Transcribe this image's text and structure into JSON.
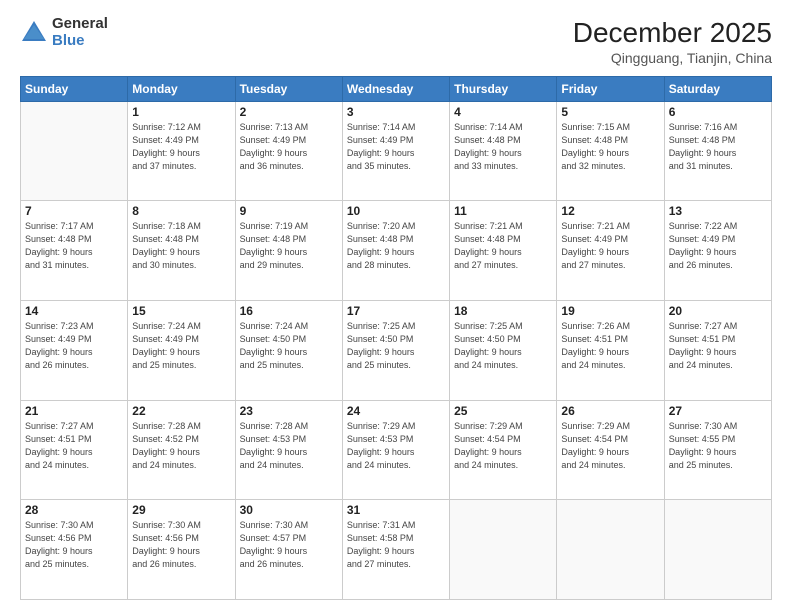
{
  "logo": {
    "general": "General",
    "blue": "Blue"
  },
  "title": {
    "month": "December 2025",
    "location": "Qingguang, Tianjin, China"
  },
  "days_header": [
    "Sunday",
    "Monday",
    "Tuesday",
    "Wednesday",
    "Thursday",
    "Friday",
    "Saturday"
  ],
  "weeks": [
    [
      {
        "day": "",
        "info": ""
      },
      {
        "day": "1",
        "info": "Sunrise: 7:12 AM\nSunset: 4:49 PM\nDaylight: 9 hours\nand 37 minutes."
      },
      {
        "day": "2",
        "info": "Sunrise: 7:13 AM\nSunset: 4:49 PM\nDaylight: 9 hours\nand 36 minutes."
      },
      {
        "day": "3",
        "info": "Sunrise: 7:14 AM\nSunset: 4:49 PM\nDaylight: 9 hours\nand 35 minutes."
      },
      {
        "day": "4",
        "info": "Sunrise: 7:14 AM\nSunset: 4:48 PM\nDaylight: 9 hours\nand 33 minutes."
      },
      {
        "day": "5",
        "info": "Sunrise: 7:15 AM\nSunset: 4:48 PM\nDaylight: 9 hours\nand 32 minutes."
      },
      {
        "day": "6",
        "info": "Sunrise: 7:16 AM\nSunset: 4:48 PM\nDaylight: 9 hours\nand 31 minutes."
      }
    ],
    [
      {
        "day": "7",
        "info": "Sunrise: 7:17 AM\nSunset: 4:48 PM\nDaylight: 9 hours\nand 31 minutes."
      },
      {
        "day": "8",
        "info": "Sunrise: 7:18 AM\nSunset: 4:48 PM\nDaylight: 9 hours\nand 30 minutes."
      },
      {
        "day": "9",
        "info": "Sunrise: 7:19 AM\nSunset: 4:48 PM\nDaylight: 9 hours\nand 29 minutes."
      },
      {
        "day": "10",
        "info": "Sunrise: 7:20 AM\nSunset: 4:48 PM\nDaylight: 9 hours\nand 28 minutes."
      },
      {
        "day": "11",
        "info": "Sunrise: 7:21 AM\nSunset: 4:48 PM\nDaylight: 9 hours\nand 27 minutes."
      },
      {
        "day": "12",
        "info": "Sunrise: 7:21 AM\nSunset: 4:49 PM\nDaylight: 9 hours\nand 27 minutes."
      },
      {
        "day": "13",
        "info": "Sunrise: 7:22 AM\nSunset: 4:49 PM\nDaylight: 9 hours\nand 26 minutes."
      }
    ],
    [
      {
        "day": "14",
        "info": "Sunrise: 7:23 AM\nSunset: 4:49 PM\nDaylight: 9 hours\nand 26 minutes."
      },
      {
        "day": "15",
        "info": "Sunrise: 7:24 AM\nSunset: 4:49 PM\nDaylight: 9 hours\nand 25 minutes."
      },
      {
        "day": "16",
        "info": "Sunrise: 7:24 AM\nSunset: 4:50 PM\nDaylight: 9 hours\nand 25 minutes."
      },
      {
        "day": "17",
        "info": "Sunrise: 7:25 AM\nSunset: 4:50 PM\nDaylight: 9 hours\nand 25 minutes."
      },
      {
        "day": "18",
        "info": "Sunrise: 7:25 AM\nSunset: 4:50 PM\nDaylight: 9 hours\nand 24 minutes."
      },
      {
        "day": "19",
        "info": "Sunrise: 7:26 AM\nSunset: 4:51 PM\nDaylight: 9 hours\nand 24 minutes."
      },
      {
        "day": "20",
        "info": "Sunrise: 7:27 AM\nSunset: 4:51 PM\nDaylight: 9 hours\nand 24 minutes."
      }
    ],
    [
      {
        "day": "21",
        "info": "Sunrise: 7:27 AM\nSunset: 4:51 PM\nDaylight: 9 hours\nand 24 minutes."
      },
      {
        "day": "22",
        "info": "Sunrise: 7:28 AM\nSunset: 4:52 PM\nDaylight: 9 hours\nand 24 minutes."
      },
      {
        "day": "23",
        "info": "Sunrise: 7:28 AM\nSunset: 4:53 PM\nDaylight: 9 hours\nand 24 minutes."
      },
      {
        "day": "24",
        "info": "Sunrise: 7:29 AM\nSunset: 4:53 PM\nDaylight: 9 hours\nand 24 minutes."
      },
      {
        "day": "25",
        "info": "Sunrise: 7:29 AM\nSunset: 4:54 PM\nDaylight: 9 hours\nand 24 minutes."
      },
      {
        "day": "26",
        "info": "Sunrise: 7:29 AM\nSunset: 4:54 PM\nDaylight: 9 hours\nand 24 minutes."
      },
      {
        "day": "27",
        "info": "Sunrise: 7:30 AM\nSunset: 4:55 PM\nDaylight: 9 hours\nand 25 minutes."
      }
    ],
    [
      {
        "day": "28",
        "info": "Sunrise: 7:30 AM\nSunset: 4:56 PM\nDaylight: 9 hours\nand 25 minutes."
      },
      {
        "day": "29",
        "info": "Sunrise: 7:30 AM\nSunset: 4:56 PM\nDaylight: 9 hours\nand 26 minutes."
      },
      {
        "day": "30",
        "info": "Sunrise: 7:30 AM\nSunset: 4:57 PM\nDaylight: 9 hours\nand 26 minutes."
      },
      {
        "day": "31",
        "info": "Sunrise: 7:31 AM\nSunset: 4:58 PM\nDaylight: 9 hours\nand 27 minutes."
      },
      {
        "day": "",
        "info": ""
      },
      {
        "day": "",
        "info": ""
      },
      {
        "day": "",
        "info": ""
      }
    ]
  ]
}
